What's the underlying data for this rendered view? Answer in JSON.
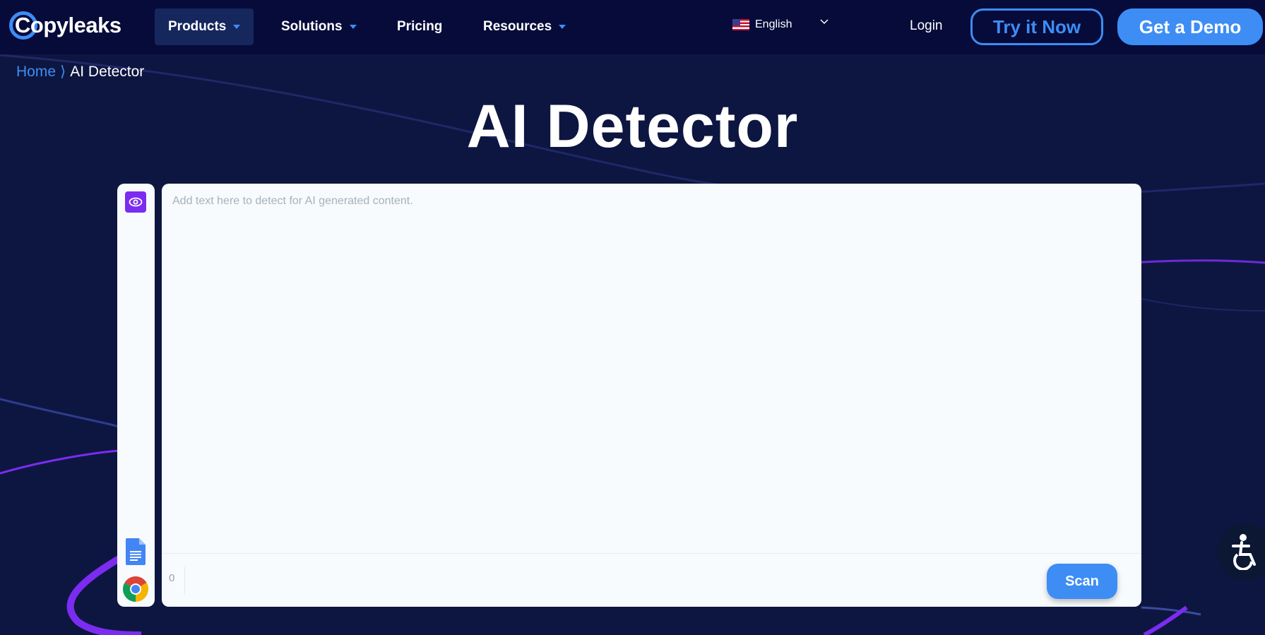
{
  "nav": {
    "logo_text": "Copyleaks",
    "items": [
      {
        "label": "Products"
      },
      {
        "label": "Solutions"
      },
      {
        "label": "Pricing"
      },
      {
        "label": "Resources"
      }
    ],
    "language": "English",
    "login": "Login",
    "try_button": "Try it Now",
    "demo_button": "Get a Demo"
  },
  "breadcrumb": {
    "home": "Home",
    "separator": "⟩",
    "current": "AI Detector"
  },
  "page_title": "AI Detector",
  "editor": {
    "placeholder": "Add text here to detect for AI generated content.",
    "value": "",
    "word_count": "0",
    "scan_button": "Scan"
  },
  "icons": {
    "eye": "eye-icon",
    "google_docs": "google-docs-icon",
    "chrome": "chrome-icon",
    "accessibility": "accessibility-icon"
  },
  "colors": {
    "brand_blue": "#3d8df5",
    "nav_bg": "#060b3a",
    "page_bg": "#0d1640",
    "purple": "#7b2cf0"
  }
}
